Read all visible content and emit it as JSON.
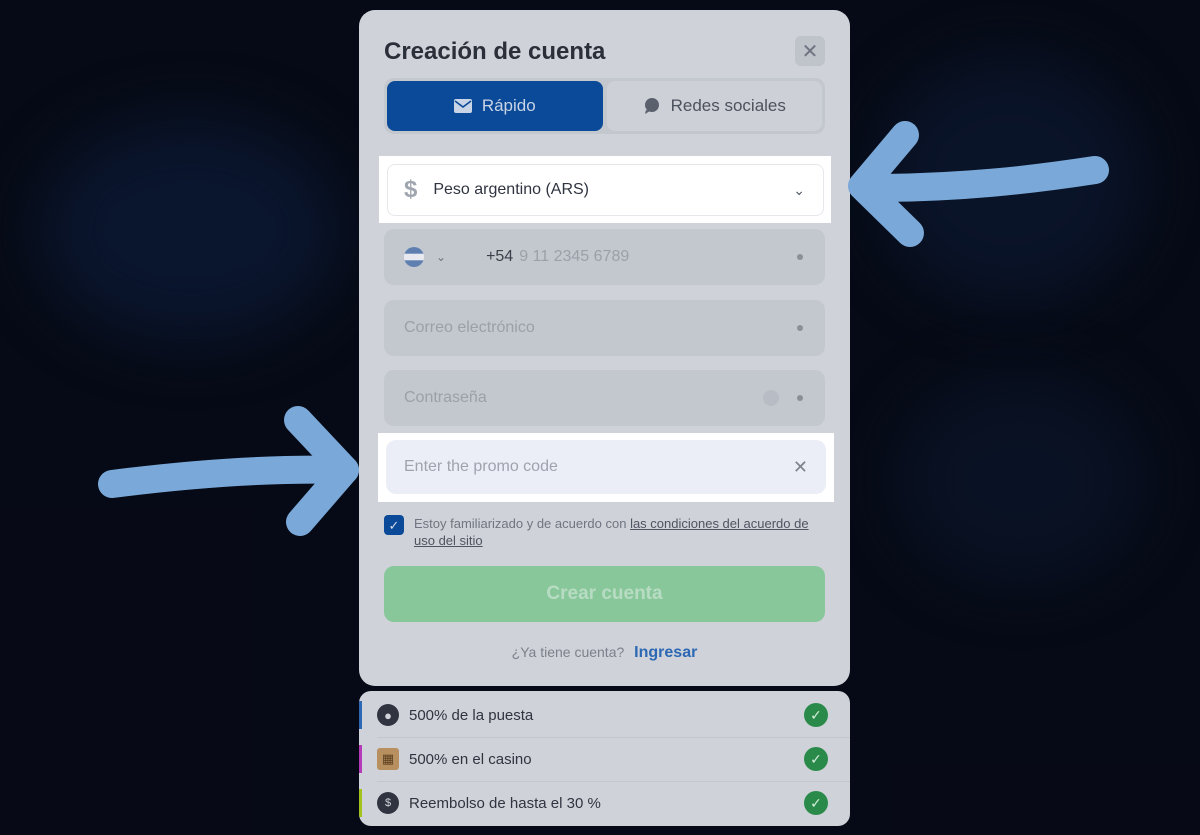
{
  "modal": {
    "title": "Creación de cuenta",
    "close_icon": "close-icon",
    "tabs": [
      {
        "label": "Rápido",
        "icon": "mail-icon",
        "active": true
      },
      {
        "label": "Redes sociales",
        "icon": "chat-icon",
        "active": false
      }
    ],
    "currency": {
      "symbol": "$",
      "value": "Peso argentino (ARS)"
    },
    "phone": {
      "code": "+54",
      "placeholder": "9 11 2345 6789",
      "flag": "argentina-flag-icon"
    },
    "email_placeholder": "Correo electrónico",
    "password_placeholder": "Contraseña",
    "promo_placeholder": "Enter the promo code",
    "terms": {
      "text": "Estoy familiarizado y de acuerdo con ",
      "link": "las condiciones del acuerdo de uso del sitio"
    },
    "create_button": "Crear cuenta",
    "login_prompt": "¿Ya tiene cuenta?",
    "login_link": "Ingresar"
  },
  "bonuses": [
    {
      "label": "500% de la puesta",
      "icon": "soccer-ball-icon",
      "color": "#2c68b3"
    },
    {
      "label": "500% en el casino",
      "icon": "casino-icon",
      "color": "#b43ab8"
    },
    {
      "label": "Reembolso de hasta el 30 %",
      "icon": "cashback-icon",
      "color": "#a4c21e"
    }
  ],
  "colors": {
    "primary": "#0b4a98",
    "success": "#2a8a4a",
    "arrow": "#7aa9d9"
  }
}
